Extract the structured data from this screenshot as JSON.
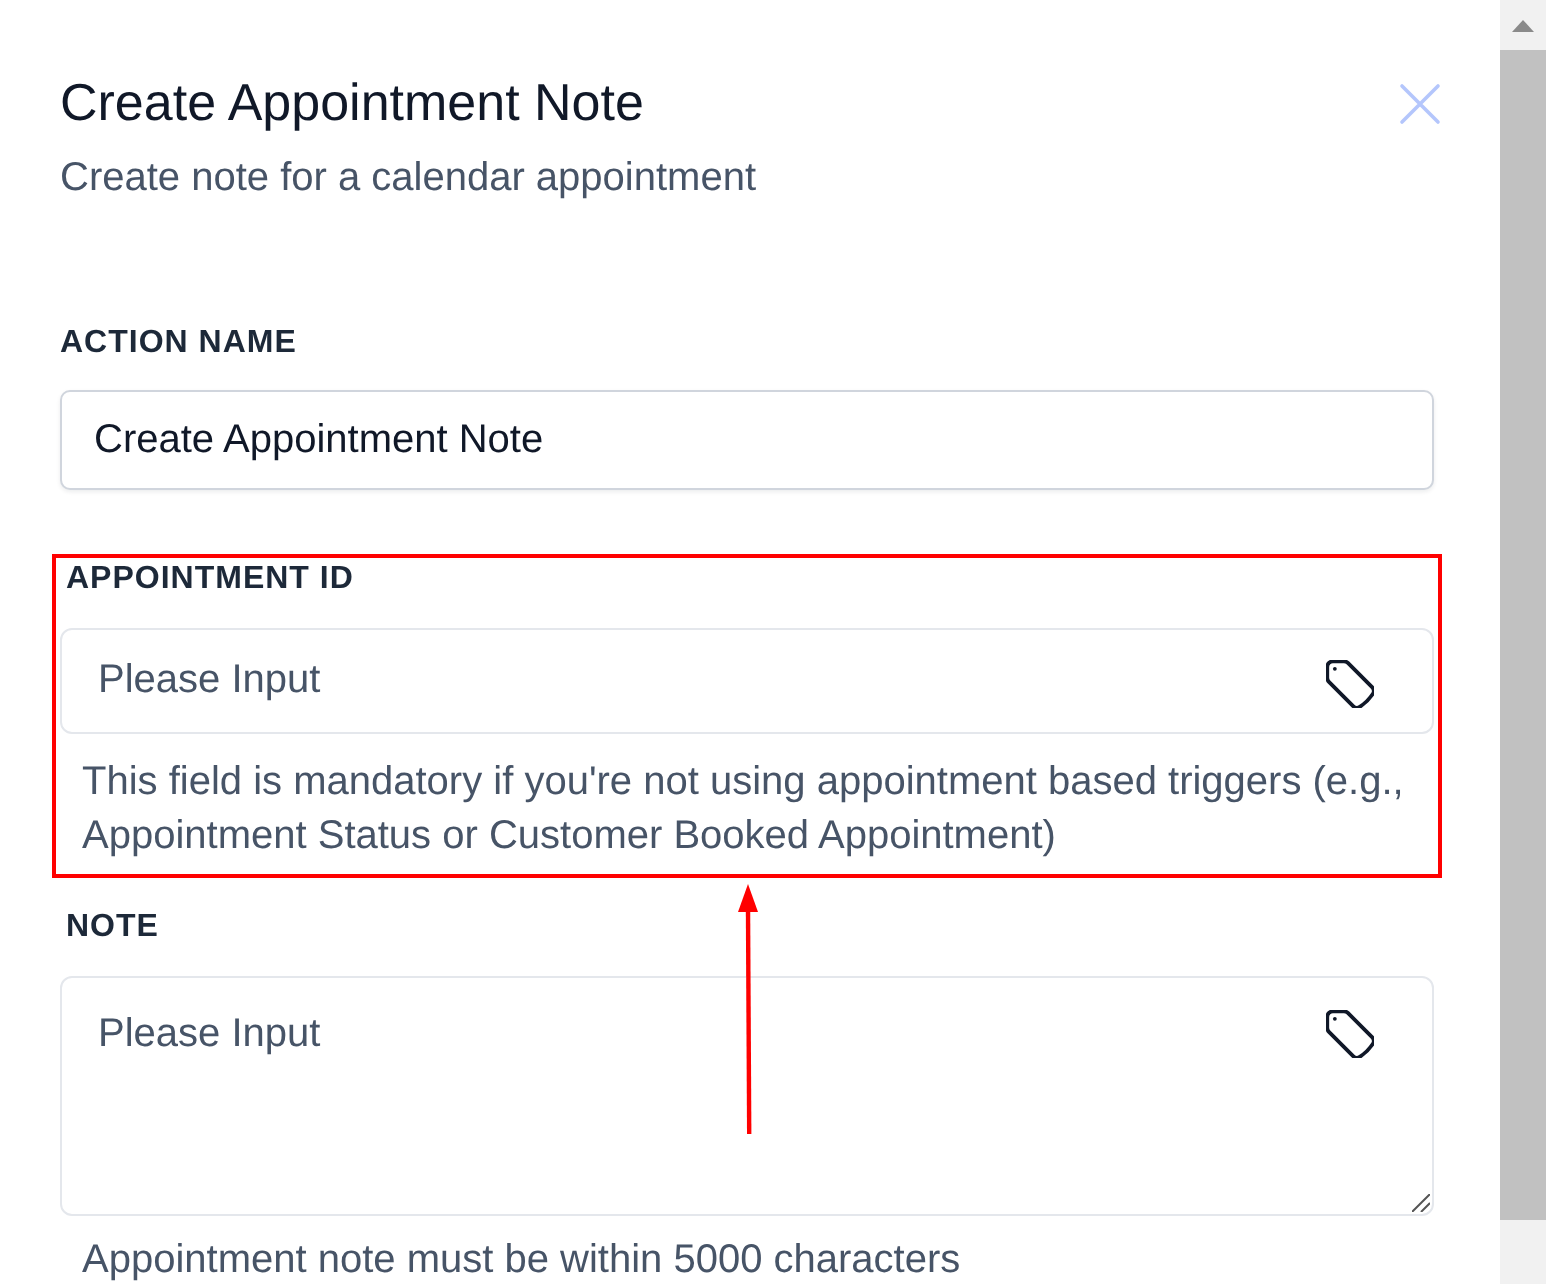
{
  "drawer": {
    "title": "Create Appointment Note",
    "subtitle": "Create note for a calendar appointment"
  },
  "fields": [
    {
      "kind": "text",
      "label": "ACTION NAME",
      "value": "Create Appointment Note",
      "highlighted": false
    },
    {
      "kind": "tag-input",
      "label": "APPOINTMENT ID",
      "placeholder": "Please Input",
      "help": "This field is mandatory if you're not using appointment based triggers (e.g., Appointment Status or Customer Booked Appointment)",
      "highlighted": true
    },
    {
      "kind": "tag-textarea",
      "label": "NOTE",
      "placeholder": "Please Input",
      "help": "Appointment note must be within 5000 characters",
      "highlighted": false
    }
  ]
}
